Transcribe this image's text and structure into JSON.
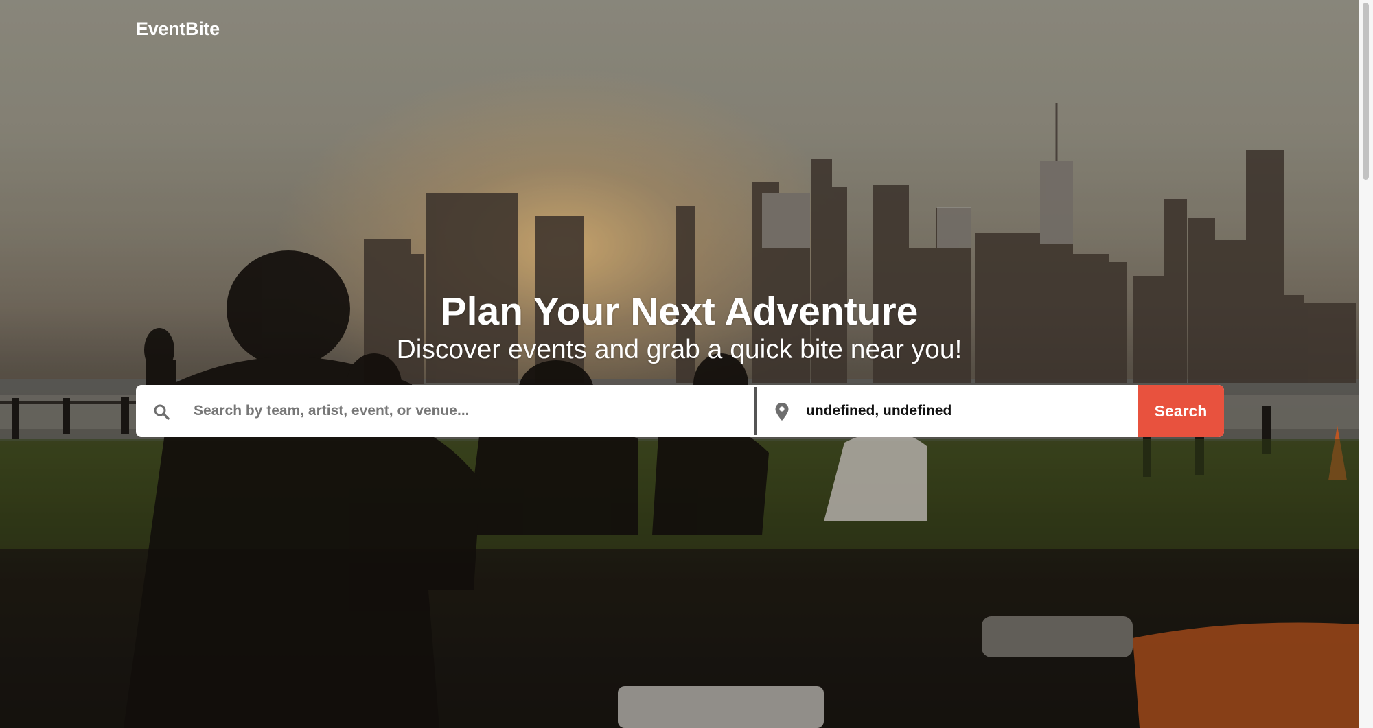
{
  "header": {
    "logo_text": "EventBite"
  },
  "hero": {
    "title": "Plan Your Next Adventure",
    "subtitle": "Discover events and grab a quick bite near you!"
  },
  "search": {
    "query_placeholder": "Search by team, artist, event, or venue...",
    "query_value": "",
    "location_value": "undefined, undefined",
    "button_label": "Search",
    "icons": {
      "query": "search-icon",
      "location": "map-pin-icon"
    }
  },
  "colors": {
    "accent": "#e8523e",
    "text_light": "#ffffff",
    "search_bg": "#ffffff"
  }
}
